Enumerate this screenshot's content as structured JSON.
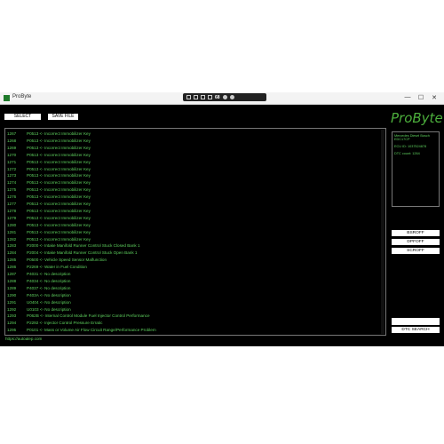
{
  "window": {
    "title": "ProByte",
    "minimize": "—",
    "maximize": "☐",
    "close": "✕",
    "zoom": "68"
  },
  "buttons": {
    "select_module": "SELECT MODULE",
    "save_file": "SAVE FILE",
    "bsroff": "BSROFF",
    "dpfoff": "DPFOFF",
    "scroff": "SCROFF",
    "dtc_search": "DTC SEARCH"
  },
  "logo": "ProByte",
  "info": {
    "ecu_name": "Mercedes Diesel Bosch EDC17CP",
    "ecu_id": "ECU ID: 1037524878",
    "dtc_count": "DTC count: 1264"
  },
  "dtc_rows": [
    {
      "num": "1267",
      "text": "P0513 <- Incorrect Immobilizer Key"
    },
    {
      "num": "1268",
      "text": "P0513 <- Incorrect Immobilizer Key"
    },
    {
      "num": "1269",
      "text": "P0513 <- Incorrect Immobilizer Key"
    },
    {
      "num": "1270",
      "text": "P0513 <- Incorrect Immobilizer Key"
    },
    {
      "num": "1271",
      "text": "P0513 <- Incorrect Immobilizer Key"
    },
    {
      "num": "1272",
      "text": "P0513 <- Incorrect Immobilizer Key"
    },
    {
      "num": "1273",
      "text": "P0513 <- Incorrect Immobilizer Key"
    },
    {
      "num": "1274",
      "text": "P0513 <- Incorrect Immobilizer Key"
    },
    {
      "num": "1275",
      "text": "P0513 <- Incorrect Immobilizer Key"
    },
    {
      "num": "1276",
      "text": "P0513 <- Incorrect Immobilizer Key"
    },
    {
      "num": "1277",
      "text": "P0513 <- Incorrect Immobilizer Key"
    },
    {
      "num": "1278",
      "text": "P0513 <- Incorrect Immobilizer Key"
    },
    {
      "num": "1279",
      "text": "P0513 <- Incorrect Immobilizer Key"
    },
    {
      "num": "1280",
      "text": "P0513 <- Incorrect Immobilizer Key"
    },
    {
      "num": "1281",
      "text": "P0513 <- Incorrect Immobilizer Key"
    },
    {
      "num": "1282",
      "text": "P0513 <- Incorrect Immobilizer Key"
    },
    {
      "num": "1283",
      "text": "P2000 <- Intake Manifold Runner Control Stuck Closed Bank 1"
    },
    {
      "num": "1284",
      "text": "P2004 <- Intake Manifold Runner Control Stuck Open Bank 1"
    },
    {
      "num": "1285",
      "text": "P0500 <- Vehicle Speed Sensor Malfunction"
    },
    {
      "num": "1286",
      "text": "P2269 <- Water in Fuel Condition"
    },
    {
      "num": "1287",
      "text": "P4031 <- No description"
    },
    {
      "num": "1288",
      "text": "P4034 <- No description"
    },
    {
      "num": "1289",
      "text": "P4037 <- No description"
    },
    {
      "num": "1290",
      "text": "P403A <- No description"
    },
    {
      "num": "1291",
      "text": "U0404 <- No description"
    },
    {
      "num": "1292",
      "text": "U0103 <- No description"
    },
    {
      "num": "1293",
      "text": "P062B <- Internal Control Module Fuel Injector Control Performance"
    },
    {
      "num": "1294",
      "text": "P2292 <- Injector Control Pressure Erratic"
    },
    {
      "num": "1295",
      "text": "P0101 <- Mass or Volume Air Flow Circuit Range/Performance Problem"
    }
  ],
  "url": "https://autoalep.com"
}
